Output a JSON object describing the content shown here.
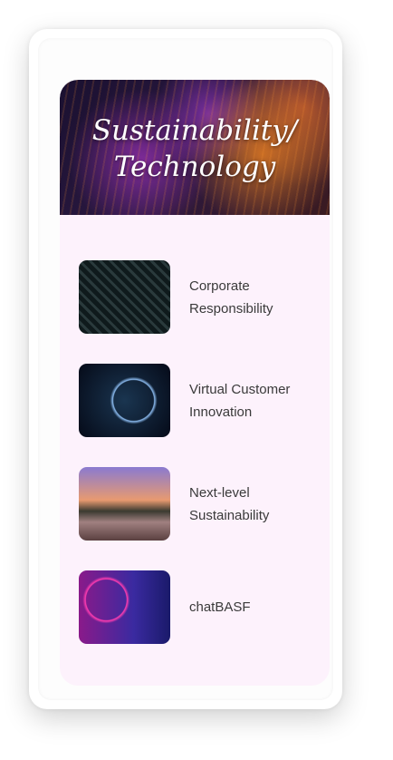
{
  "header": {
    "title_line1": "Sustainability/",
    "title_line2": "Technology"
  },
  "items": [
    {
      "line1": "Corporate",
      "line2": "Responsibility",
      "image": "circuit-roads-image"
    },
    {
      "line1": "Virtual Customer",
      "line2": "Innovation",
      "image": "space-ring-image"
    },
    {
      "line1": "Next-level",
      "line2": "Sustainability",
      "image": "harvester-field-image"
    },
    {
      "line1": "chatBASF",
      "line2": "",
      "image": "neon-robot-image"
    }
  ],
  "colors": {
    "panel": "#fdf2fc",
    "text": "#3a3a3a"
  }
}
